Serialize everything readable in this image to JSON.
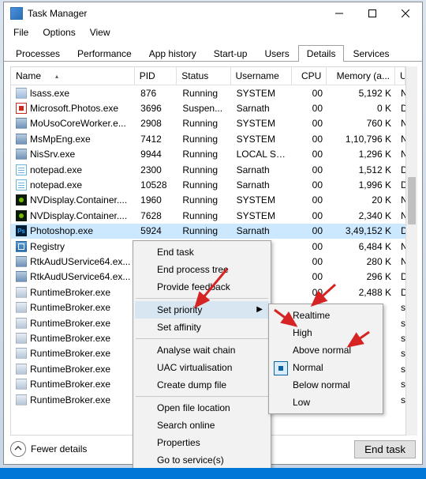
{
  "window": {
    "title": "Task Manager"
  },
  "menubar": [
    "File",
    "Options",
    "View"
  ],
  "tabs": [
    {
      "label": "Processes",
      "active": false
    },
    {
      "label": "Performance",
      "active": false
    },
    {
      "label": "App history",
      "active": false
    },
    {
      "label": "Start-up",
      "active": false
    },
    {
      "label": "Users",
      "active": false
    },
    {
      "label": "Details",
      "active": true
    },
    {
      "label": "Services",
      "active": false
    }
  ],
  "columns": {
    "name": "Name",
    "pid": "PID",
    "status": "Status",
    "user": "Username",
    "cpu": "CPU",
    "mem": "Memory (a...",
    "uac": "UAC vir...",
    "sort": "name",
    "dir": "asc"
  },
  "rows": [
    {
      "icon": "sys",
      "name": "lsass.exe",
      "pid": "876",
      "status": "Running",
      "user": "SYSTEM",
      "cpu": "00",
      "mem": "5,192 K",
      "uac": "Not all..."
    },
    {
      "icon": "photos",
      "name": "Microsoft.Photos.exe",
      "pid": "3696",
      "status": "Suspen...",
      "user": "Sarnath",
      "cpu": "00",
      "mem": "0 K",
      "uac": "Disabled"
    },
    {
      "icon": "svc",
      "name": "MoUsoCoreWorker.e...",
      "pid": "2908",
      "status": "Running",
      "user": "SYSTEM",
      "cpu": "00",
      "mem": "760 K",
      "uac": "Not all..."
    },
    {
      "icon": "svc",
      "name": "MsMpEng.exe",
      "pid": "7412",
      "status": "Running",
      "user": "SYSTEM",
      "cpu": "00",
      "mem": "1,10,796 K",
      "uac": "Not all..."
    },
    {
      "icon": "svc",
      "name": "NisSrv.exe",
      "pid": "9944",
      "status": "Running",
      "user": "LOCAL SE...",
      "cpu": "00",
      "mem": "1,296 K",
      "uac": "Not all..."
    },
    {
      "icon": "note",
      "name": "notepad.exe",
      "pid": "2300",
      "status": "Running",
      "user": "Sarnath",
      "cpu": "00",
      "mem": "1,512 K",
      "uac": "Disabled"
    },
    {
      "icon": "note",
      "name": "notepad.exe",
      "pid": "10528",
      "status": "Running",
      "user": "Sarnath",
      "cpu": "00",
      "mem": "1,996 K",
      "uac": "Disabled"
    },
    {
      "icon": "nv",
      "name": "NVDisplay.Container....",
      "pid": "1960",
      "status": "Running",
      "user": "SYSTEM",
      "cpu": "00",
      "mem": "20 K",
      "uac": "Not all..."
    },
    {
      "icon": "nv",
      "name": "NVDisplay.Container....",
      "pid": "7628",
      "status": "Running",
      "user": "SYSTEM",
      "cpu": "00",
      "mem": "2,340 K",
      "uac": "Not all..."
    },
    {
      "icon": "ps",
      "name": "Photoshop.exe",
      "pid": "5924",
      "status": "Running",
      "user": "Sarnath",
      "cpu": "00",
      "mem": "3,49,152 K",
      "uac": "Disabled",
      "selected": true
    },
    {
      "icon": "reg",
      "name": "Registry",
      "pid": "",
      "status": "",
      "user": "",
      "cpu": "00",
      "mem": "6,484 K",
      "uac": "Not all..."
    },
    {
      "icon": "svc",
      "name": "RtkAudUService64.ex...",
      "pid": "",
      "status": "",
      "user": "",
      "cpu": "00",
      "mem": "280 K",
      "uac": "Not all..."
    },
    {
      "icon": "svc",
      "name": "RtkAudUService64.ex...",
      "pid": "",
      "status": "",
      "user": "",
      "cpu": "00",
      "mem": "296 K",
      "uac": "Disabled"
    },
    {
      "icon": "rt",
      "name": "RuntimeBroker.exe",
      "pid": "",
      "status": "",
      "user": "",
      "cpu": "00",
      "mem": "2,488 K",
      "uac": "Disabled"
    },
    {
      "icon": "rt",
      "name": "RuntimeBroker.exe",
      "pid": "",
      "status": "",
      "user": "",
      "cpu": "",
      "mem": "",
      "uac": "sabled"
    },
    {
      "icon": "rt",
      "name": "RuntimeBroker.exe",
      "pid": "",
      "status": "",
      "user": "",
      "cpu": "",
      "mem": "",
      "uac": "sabled"
    },
    {
      "icon": "rt",
      "name": "RuntimeBroker.exe",
      "pid": "",
      "status": "",
      "user": "",
      "cpu": "",
      "mem": "",
      "uac": "sabled"
    },
    {
      "icon": "rt",
      "name": "RuntimeBroker.exe",
      "pid": "",
      "status": "",
      "user": "",
      "cpu": "",
      "mem": "",
      "uac": "sabled"
    },
    {
      "icon": "rt",
      "name": "RuntimeBroker.exe",
      "pid": "",
      "status": "",
      "user": "",
      "cpu": "",
      "mem": "",
      "uac": "sabled"
    },
    {
      "icon": "rt",
      "name": "RuntimeBroker.exe",
      "pid": "",
      "status": "",
      "user": "",
      "cpu": "",
      "mem": "",
      "uac": "sabled"
    },
    {
      "icon": "rt",
      "name": "RuntimeBroker.exe",
      "pid": "",
      "status": "",
      "user": "",
      "cpu": "",
      "mem": "",
      "uac": "sabled"
    }
  ],
  "context_menu": [
    {
      "label": "End task"
    },
    {
      "label": "End process tree"
    },
    {
      "label": "Provide feedback"
    },
    {
      "sep": true
    },
    {
      "label": "Set priority",
      "sub": true,
      "hover": true
    },
    {
      "label": "Set affinity"
    },
    {
      "sep": true
    },
    {
      "label": "Analyse wait chain"
    },
    {
      "label": "UAC virtualisation"
    },
    {
      "label": "Create dump file"
    },
    {
      "sep": true
    },
    {
      "label": "Open file location"
    },
    {
      "label": "Search online"
    },
    {
      "label": "Properties"
    },
    {
      "label": "Go to service(s)"
    }
  ],
  "priority_submenu": [
    {
      "label": "Realtime"
    },
    {
      "label": "High"
    },
    {
      "label": "Above normal"
    },
    {
      "label": "Normal",
      "checked": true
    },
    {
      "label": "Below normal"
    },
    {
      "label": "Low"
    }
  ],
  "bottom": {
    "fewer": "Fewer details",
    "endtask": "End task"
  },
  "ps_icon_text": "Ps"
}
